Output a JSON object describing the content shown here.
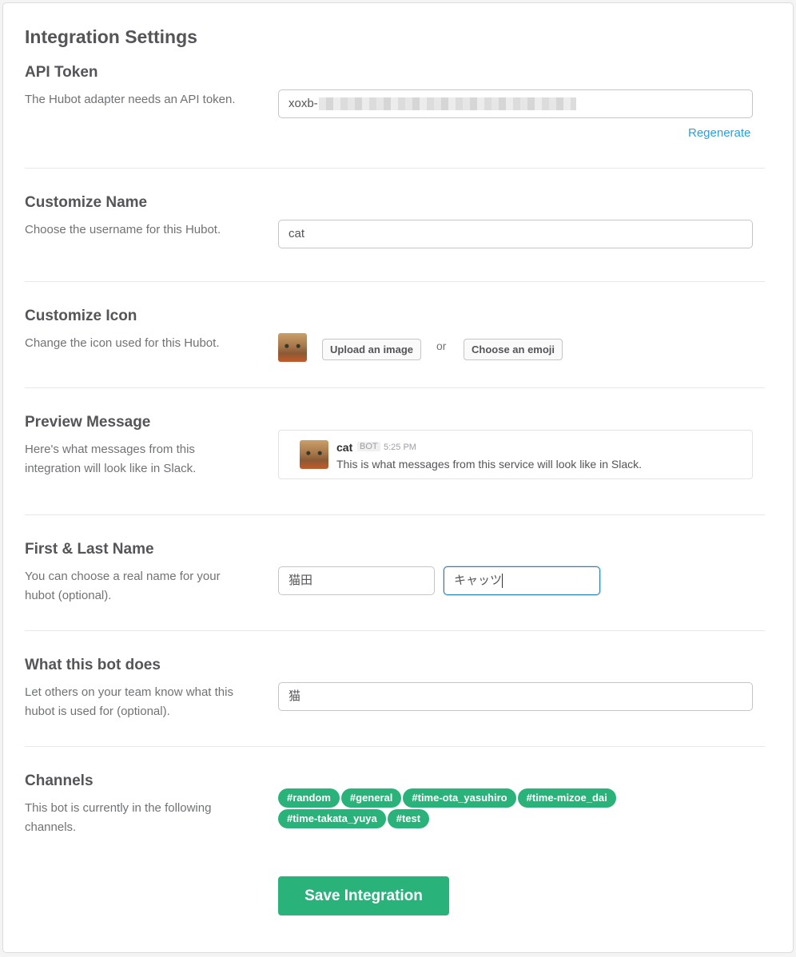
{
  "page": {
    "title": "Integration Settings"
  },
  "api_token": {
    "title": "API Token",
    "description": "The Hubot adapter needs an API token.",
    "value_prefix": "xoxb-",
    "regenerate_label": "Regenerate"
  },
  "customize_name": {
    "title": "Customize Name",
    "description": "Choose the username for this Hubot.",
    "value": "cat"
  },
  "customize_icon": {
    "title": "Customize Icon",
    "description": "Change the icon used for this Hubot.",
    "upload_label": "Upload an image",
    "or_label": "or",
    "emoji_label": "Choose an emoji"
  },
  "preview_message": {
    "title": "Preview Message",
    "description": "Here's what messages from this integration will look like in Slack.",
    "name": "cat",
    "badge": "BOT",
    "time": "5:25 PM",
    "text": "This is what messages from this service will look like in Slack."
  },
  "first_last_name": {
    "title": "First & Last Name",
    "description": "You can choose a real name for your hubot (optional).",
    "first_value": "猫田",
    "last_value": "キャッツ"
  },
  "what_bot_does": {
    "title": "What this bot does",
    "description": "Let others on your team know what this hubot is used for (optional).",
    "value": "猫"
  },
  "channels": {
    "title": "Channels",
    "description": "This bot is currently in the following channels.",
    "items": [
      "#random",
      "#general",
      "#time-ota_yasuhiro",
      "#time-mizoe_dai",
      "#time-takata_yuya",
      "#test"
    ]
  },
  "save_label": "Save Integration",
  "colors": {
    "accent_green": "#2ab27b",
    "link_blue": "#2d9ee0",
    "focus_blue": "#2a80b9"
  }
}
